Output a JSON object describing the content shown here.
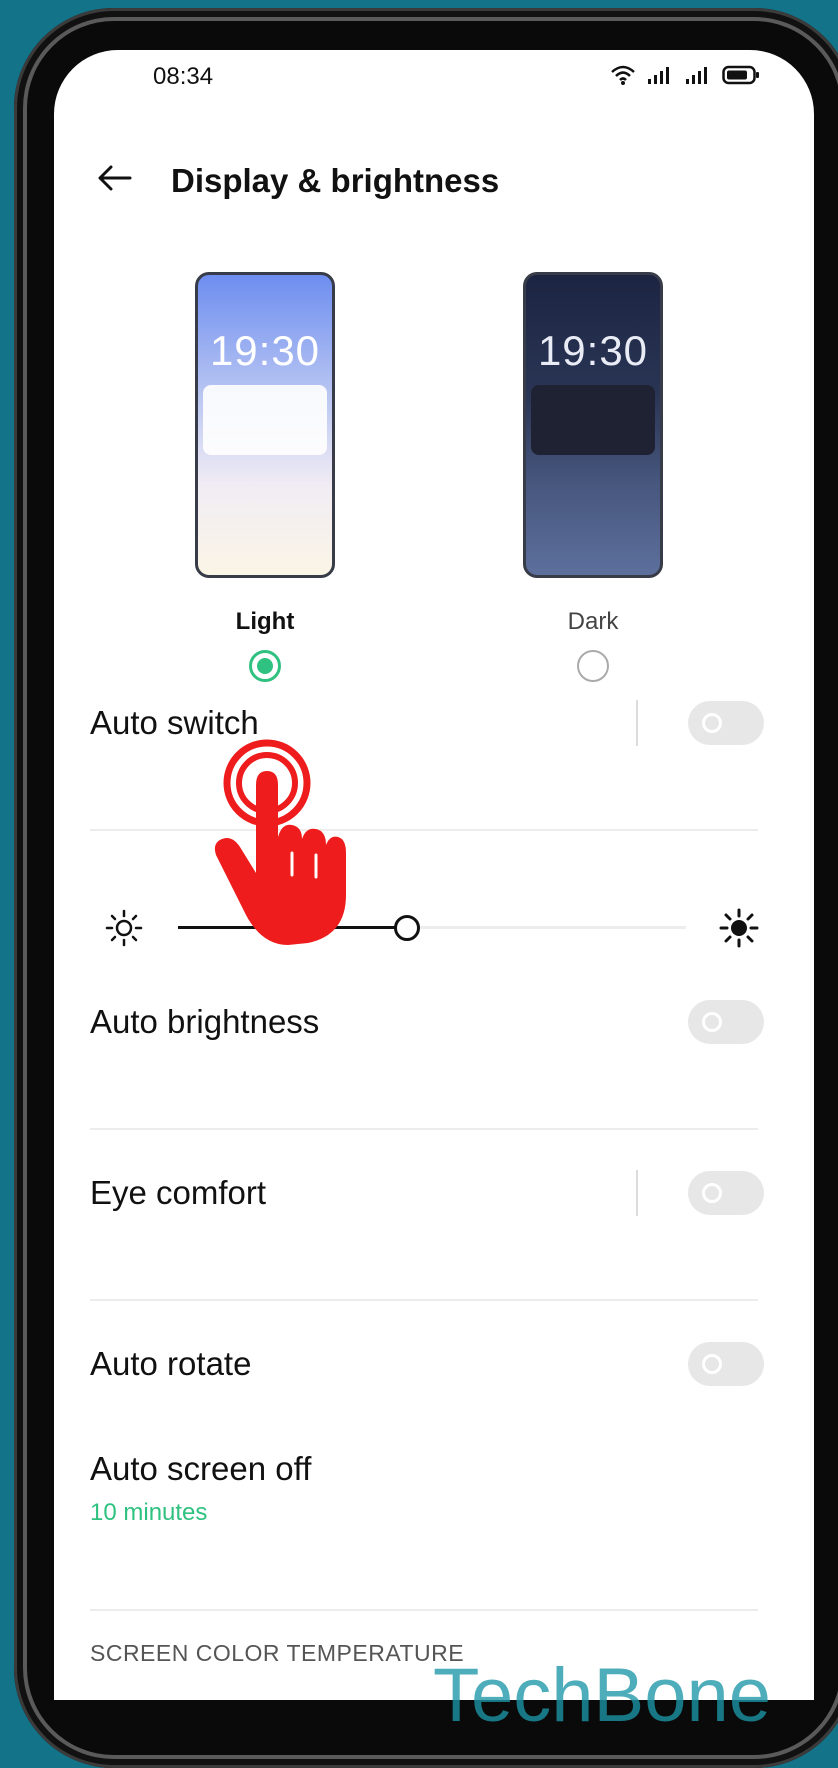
{
  "status_bar": {
    "time": "08:34"
  },
  "header": {
    "title": "Display & brightness"
  },
  "themes": [
    {
      "label": "Light",
      "preview_time": "19:30",
      "selected": true
    },
    {
      "label": "Dark",
      "preview_time": "19:30",
      "selected": false
    }
  ],
  "settings": {
    "auto_switch": {
      "label": "Auto switch",
      "on": false
    },
    "brightness": {
      "level_percent": 45
    },
    "auto_brightness": {
      "label": "Auto brightness",
      "on": false
    },
    "eye_comfort": {
      "label": "Eye comfort",
      "on": false
    },
    "auto_rotate": {
      "label": "Auto rotate",
      "on": false
    },
    "auto_screen_off": {
      "label": "Auto screen off",
      "value": "10 minutes"
    }
  },
  "section_header": "SCREEN COLOR TEMPERATURE",
  "watermark": "TechBone",
  "colors": {
    "accent": "#2fc17f",
    "background": "#137489",
    "tap_indicator": "#ee1c1c"
  },
  "icons": [
    "back-arrow-icon",
    "wifi-icon",
    "signal-icon",
    "battery-icon",
    "sun-dim-icon",
    "sun-bright-icon",
    "tap-hand-icon"
  ]
}
